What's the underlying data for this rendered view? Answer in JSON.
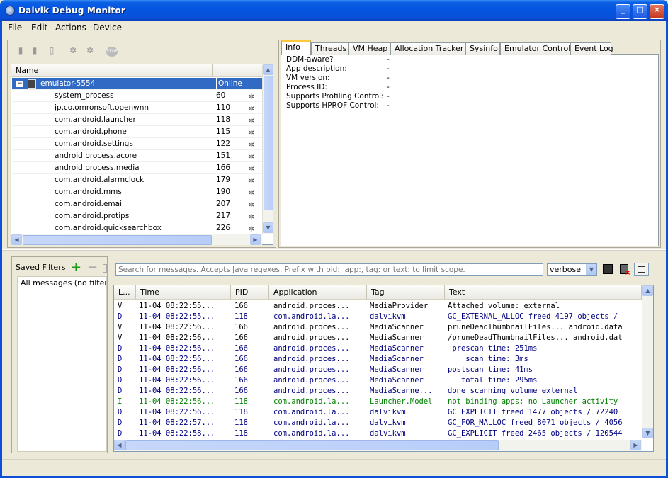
{
  "window": {
    "title": "Dalvik Debug Monitor"
  },
  "menu": [
    "File",
    "Edit",
    "Actions",
    "Device"
  ],
  "toolbar_icons": [
    "debug-icon",
    "update-heap-icon",
    "dump-hprof-icon",
    "cause-gc-icon",
    "update-threads-icon",
    "stop-icon"
  ],
  "devices": {
    "header": {
      "name": "Name"
    },
    "emulator": {
      "name": "emulator-5554",
      "status": "Online"
    },
    "processes": [
      {
        "name": "system_process",
        "pid": "60"
      },
      {
        "name": "jp.co.omronsoft.openwnn",
        "pid": "110"
      },
      {
        "name": "com.android.launcher",
        "pid": "118"
      },
      {
        "name": "com.android.phone",
        "pid": "115"
      },
      {
        "name": "com.android.settings",
        "pid": "122"
      },
      {
        "name": "android.process.acore",
        "pid": "151"
      },
      {
        "name": "android.process.media",
        "pid": "166"
      },
      {
        "name": "com.android.alarmclock",
        "pid": "179"
      },
      {
        "name": "com.android.mms",
        "pid": "190"
      },
      {
        "name": "com.android.email",
        "pid": "207"
      },
      {
        "name": "com.android.protips",
        "pid": "217"
      },
      {
        "name": "com.android.quicksearchbox",
        "pid": "226"
      }
    ]
  },
  "tabs": [
    "Info",
    "Threads",
    "VM Heap",
    "Allocation Tracker",
    "Sysinfo",
    "Emulator Control",
    "Event Log"
  ],
  "info": [
    {
      "label": "DDM-aware?",
      "value": "-"
    },
    {
      "label": "App description:",
      "value": "-"
    },
    {
      "label": "VM version:",
      "value": "-"
    },
    {
      "label": "Process ID:",
      "value": "-"
    },
    {
      "label": "Supports Profiling Control:",
      "value": "-"
    },
    {
      "label": "Supports HPROF Control:",
      "value": "-"
    }
  ],
  "filters": {
    "title": "Saved Filters",
    "items": [
      "All messages (no filters"
    ]
  },
  "log": {
    "search_placeholder": "Search for messages. Accepts Java regexes. Prefix with pid:, app:, tag: or text: to limit scope.",
    "level": "verbose",
    "headers": [
      "L...",
      "Time",
      "PID",
      "Application",
      "Tag",
      "Text"
    ],
    "rows": [
      {
        "l": "V",
        "time": "11-04 08:22:55...",
        "pid": "166",
        "app": "android.proces...",
        "tag": "MediaProvider",
        "text": "Attached volume: external"
      },
      {
        "l": "D",
        "time": "11-04 08:22:55...",
        "pid": "118",
        "app": "com.android.la...",
        "tag": "dalvikvm",
        "text": "GC_EXTERNAL_ALLOC freed 4197 objects /"
      },
      {
        "l": "V",
        "time": "11-04 08:22:56...",
        "pid": "166",
        "app": "android.proces...",
        "tag": "MediaScanner",
        "text": "pruneDeadThumbnailFiles... android.data"
      },
      {
        "l": "V",
        "time": "11-04 08:22:56...",
        "pid": "166",
        "app": "android.proces...",
        "tag": "MediaScanner",
        "text": "/pruneDeadThumbnailFiles... android.dat"
      },
      {
        "l": "D",
        "time": "11-04 08:22:56...",
        "pid": "166",
        "app": "android.proces...",
        "tag": "MediaScanner",
        "text": " prescan time: 251ms"
      },
      {
        "l": "D",
        "time": "11-04 08:22:56...",
        "pid": "166",
        "app": "android.proces...",
        "tag": "MediaScanner",
        "text": "    scan time: 3ms"
      },
      {
        "l": "D",
        "time": "11-04 08:22:56...",
        "pid": "166",
        "app": "android.proces...",
        "tag": "MediaScanner",
        "text": "postscan time: 41ms"
      },
      {
        "l": "D",
        "time": "11-04 08:22:56...",
        "pid": "166",
        "app": "android.proces...",
        "tag": "MediaScanner",
        "text": "   total time: 295ms"
      },
      {
        "l": "D",
        "time": "11-04 08:22:56...",
        "pid": "166",
        "app": "android.proces...",
        "tag": "MediaScanne...",
        "text": "done scanning volume external"
      },
      {
        "l": "I",
        "time": "11-04 08:22:56...",
        "pid": "118",
        "app": "com.android.la...",
        "tag": "Launcher.Model",
        "text": "not binding apps: no Launcher activity"
      },
      {
        "l": "D",
        "time": "11-04 08:22:56...",
        "pid": "118",
        "app": "com.android.la...",
        "tag": "dalvikvm",
        "text": "GC_EXPLICIT freed 1477 objects / 72240"
      },
      {
        "l": "D",
        "time": "11-04 08:22:57...",
        "pid": "118",
        "app": "com.android.la...",
        "tag": "dalvikvm",
        "text": "GC_FOR_MALLOC freed 8071 objects / 4056"
      },
      {
        "l": "D",
        "time": "11-04 08:22:58...",
        "pid": "118",
        "app": "com.android.la...",
        "tag": "dalvikvm",
        "text": "GC_EXPLICIT freed 2465 objects / 120544"
      }
    ]
  },
  "colors": {
    "selection": "#316ac5",
    "level_v": "#000000",
    "level_d": "#00007f",
    "level_i": "#007f00"
  }
}
